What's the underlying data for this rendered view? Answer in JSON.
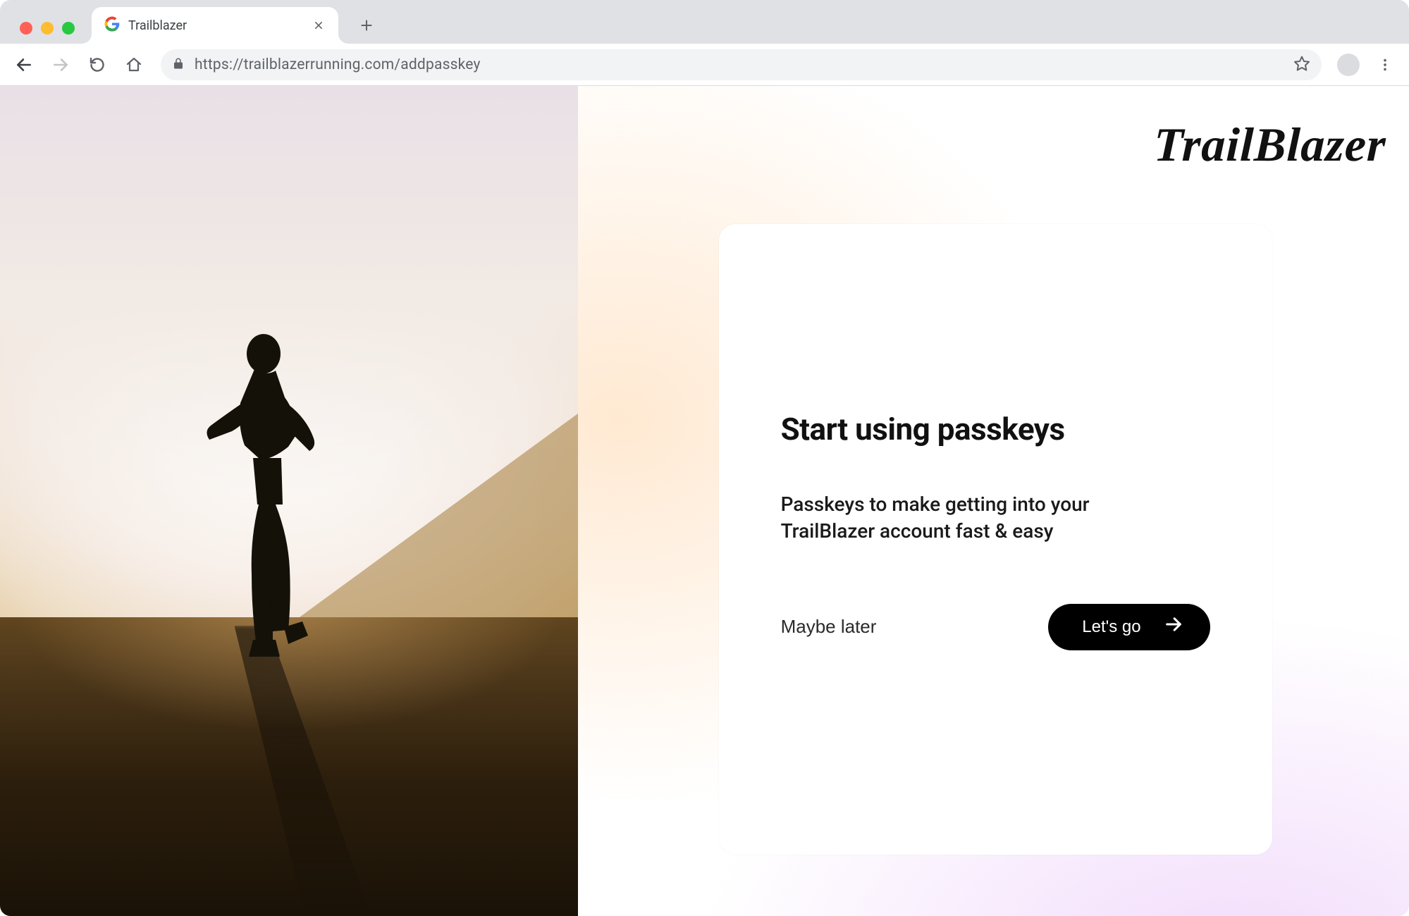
{
  "browser": {
    "tab_title": "Trailblazer",
    "url": "https://trailblazerrunning.com/addpasskey"
  },
  "page": {
    "brand": "TrailBlazer",
    "heading": "Start using passkeys",
    "subtext": "Passkeys to make getting into your TrailBlazer account fast & easy",
    "secondary_btn": "Maybe later",
    "primary_btn": "Let's go"
  }
}
